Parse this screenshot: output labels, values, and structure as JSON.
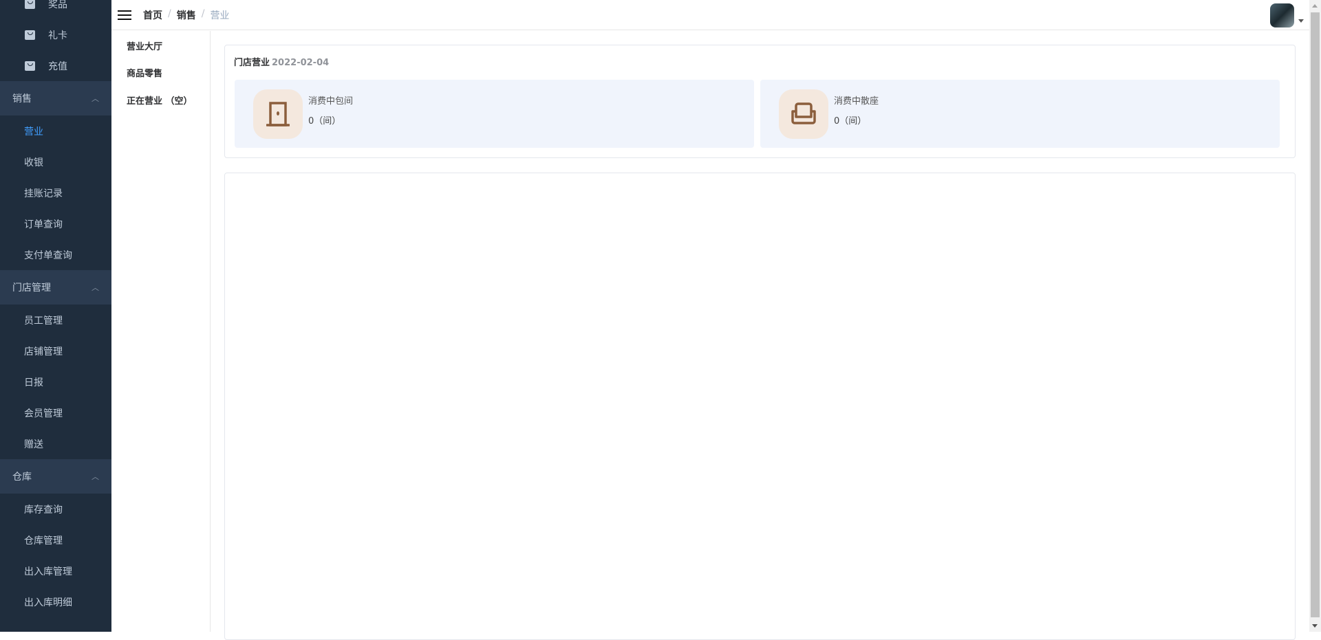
{
  "sidebar": {
    "top_items": [
      {
        "label": "奖品",
        "icon": "bag-icon"
      },
      {
        "label": "礼卡",
        "icon": "bag-icon"
      },
      {
        "label": "充值",
        "icon": "bag-icon"
      }
    ],
    "groups": [
      {
        "label": "销售",
        "items": [
          "营业",
          "收银",
          "挂账记录",
          "订单查询",
          "支付单查询"
        ],
        "active": "营业"
      },
      {
        "label": "门店管理",
        "items": [
          "员工管理",
          "店铺管理",
          "日报",
          "会员管理",
          "赠送"
        ]
      },
      {
        "label": "仓库",
        "items": [
          "库存查询",
          "仓库管理",
          "出入库管理",
          "出入库明细"
        ]
      }
    ],
    "active_color": "#409eff"
  },
  "header": {
    "breadcrumb": [
      "首页",
      "销售",
      "营业"
    ],
    "separator": "/"
  },
  "subnav": {
    "items": [
      "营业大厅",
      "商品零售",
      "正在营业 （空）"
    ]
  },
  "store": {
    "title": "门店营业",
    "date": "2022-02-04",
    "tiles": [
      {
        "label": "消费中包间",
        "value": "0（间）",
        "icon": "door-icon"
      },
      {
        "label": "消费中散座",
        "value": "0（间）",
        "icon": "sofa-icon"
      }
    ]
  }
}
